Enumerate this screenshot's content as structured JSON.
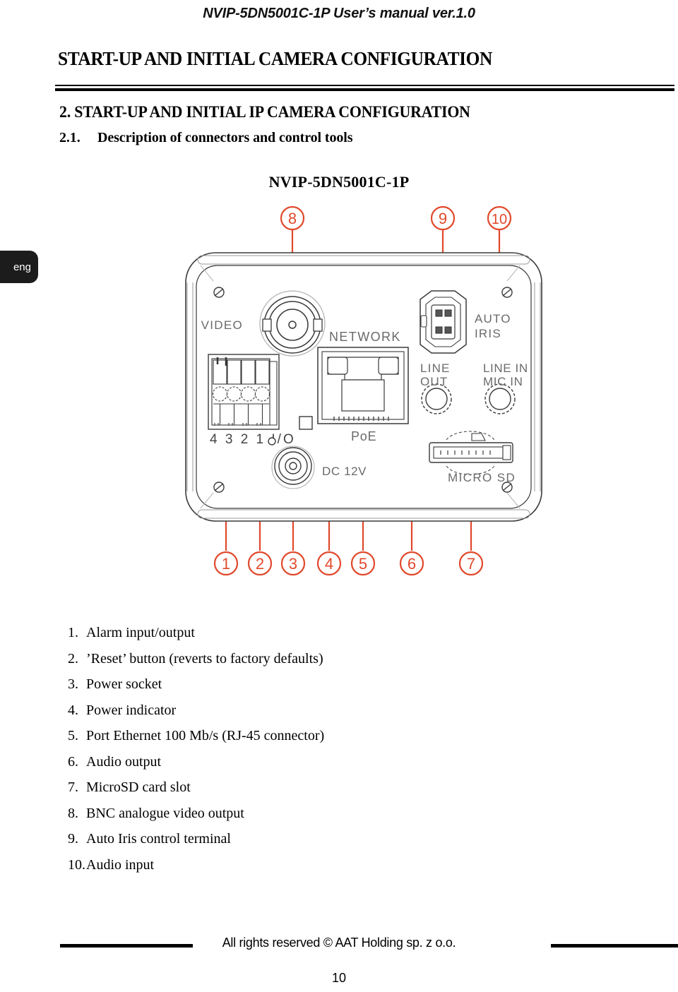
{
  "header": {
    "running_head": "NVIP-5DN5001C-1P User’s manual ver.1.0"
  },
  "title": "START-UP AND INITIAL CAMERA CONFIGURATION",
  "sections": {
    "h1": "2. START-UP AND INITIAL IP CAMERA CONFIGURATION",
    "h2_number": "2.1.",
    "h2_text": "Description of connectors and control tools"
  },
  "language_tab": "eng",
  "figure": {
    "model_name": "NVIP-5DN5001C-1P",
    "callout_color": "#E0492B",
    "outline_color": "#3a3a3a",
    "label_color": "#6a6a6a",
    "panel_labels": [
      "VIDEO",
      "NETWORK",
      "PoE",
      "DC 12V",
      "4 3 2 1 I/O",
      "AUTO",
      "IRIS",
      "LINE",
      "OUT",
      "LINE IN",
      "MIC IN",
      "MICRO SD"
    ],
    "callouts_top": [
      "8",
      "9",
      "10"
    ],
    "callouts_bottom": [
      "1",
      "2",
      "3",
      "4",
      "5",
      "6",
      "7"
    ]
  },
  "connector_list": [
    {
      "index": "1.",
      "label": "Alarm input/output"
    },
    {
      "index": "2.",
      "label": "’Reset’ button (reverts to factory defaults)"
    },
    {
      "index": "3.",
      "label": "Power socket"
    },
    {
      "index": "4.",
      "label": "Power indicator"
    },
    {
      "index": "5.",
      "label": "Port Ethernet 100 Mb/s (RJ-45 connector)"
    },
    {
      "index": "6.",
      "label": "Audio output"
    },
    {
      "index": "7.",
      "label": "MicroSD card slot"
    },
    {
      "index": "8.",
      "label": "BNC analogue video output"
    },
    {
      "index": "9.",
      "label": "Auto Iris control terminal"
    },
    {
      "index": "10.",
      "label": "Audio input"
    }
  ],
  "footer": {
    "copyright": "All rights reserved © AAT Holding sp. z o.o.",
    "page_number": "10"
  }
}
